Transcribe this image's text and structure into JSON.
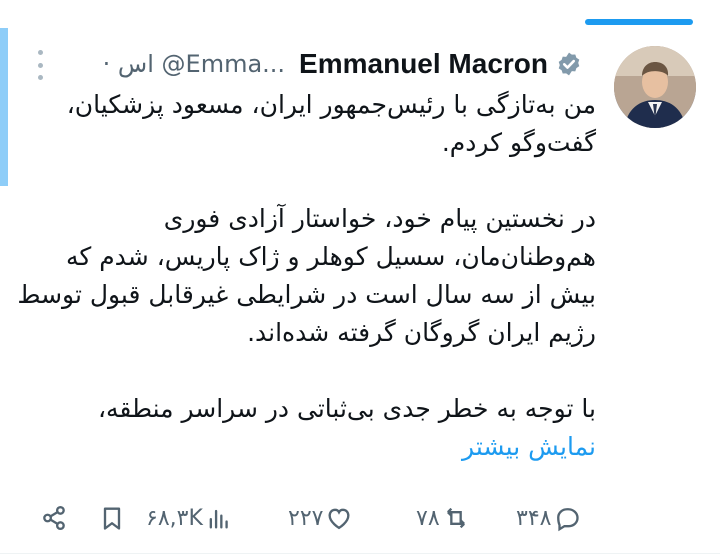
{
  "tweet": {
    "author_name": "Emmanuel Macron",
    "handle": "@Emma...",
    "time": "· اس",
    "avatar_icon": "macron-portrait",
    "verified_icon": "verified-badge-icon",
    "paragraph_1": "من به‌تازگی با رئیس‌جمهور ایران، مسعود پزشکیان، گفت‌وگو کردم.",
    "paragraph_2": "در نخستین پیام خود، خواستار آزادی فوری هم‌وطنان‌مان، سسیل کوهلر و ژاک پاریس، شدم که بیش از سه سال است در شرایطی غیرقابل قبول توسط رژیم ایران گروگان گرفته شده‌اند.",
    "paragraph_3": "با توجه به خطر جدی بی‌ثباتی در سراسر منطقه،",
    "show_more": "نمایش بیشتر"
  },
  "actions": {
    "reply_count": "۳۴۸",
    "retweet_count": "۷۸",
    "like_count": "۲۲۷",
    "views_count": "۶۸,۳K"
  },
  "colors": {
    "accent": "#1d9bf0",
    "accent_light": "#8ecdf8",
    "muted": "#536471"
  }
}
